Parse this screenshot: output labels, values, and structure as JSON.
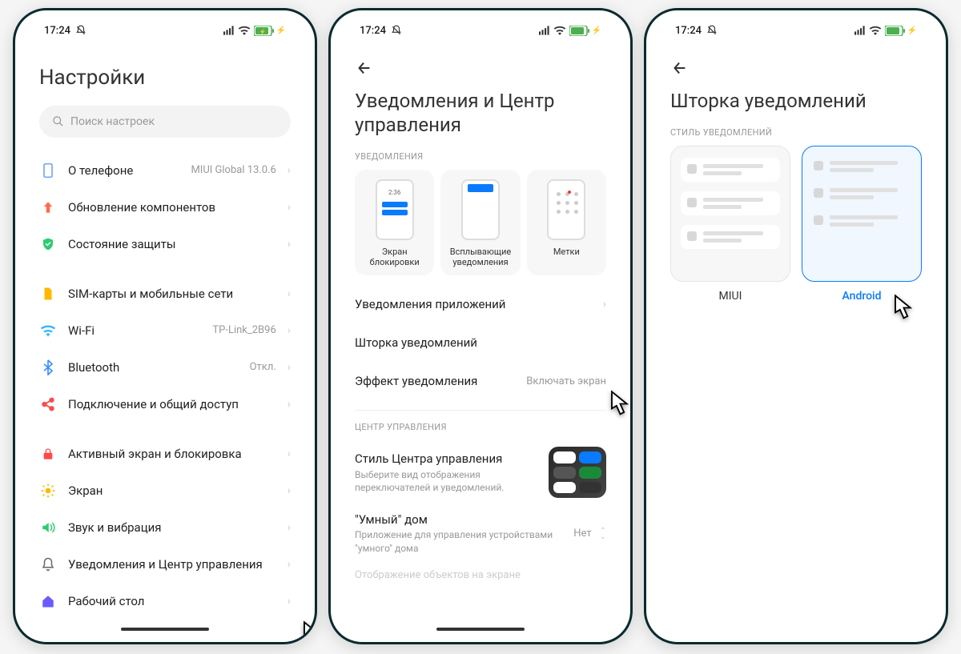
{
  "status": {
    "time": "17:24",
    "mute_icon": "bell-slash",
    "signal": "signal",
    "wifi": "wifi",
    "battery": "battery-charging"
  },
  "screen1": {
    "title": "Настройки",
    "search_placeholder": "Поиск настроек",
    "items_group1": [
      {
        "icon": "phone",
        "color": "#72a5ff",
        "label": "О телефоне",
        "value": "MIUI Global 13.0.6"
      },
      {
        "icon": "arrow-up",
        "color": "#ff6b4a",
        "label": "Обновление компонентов",
        "value": ""
      },
      {
        "icon": "shield",
        "color": "#2ecc71",
        "label": "Состояние защиты",
        "value": ""
      }
    ],
    "items_group2": [
      {
        "icon": "sim",
        "color": "#ffb800",
        "label": "SIM-карты и мобильные сети",
        "value": ""
      },
      {
        "icon": "wifi",
        "color": "#32b4ff",
        "label": "Wi-Fi",
        "value": "TP-Link_2B96"
      },
      {
        "icon": "bluetooth",
        "color": "#3a8eff",
        "label": "Bluetooth",
        "value": "Откл."
      },
      {
        "icon": "share",
        "color": "#ff4a4a",
        "label": "Подключение и общий доступ",
        "value": ""
      }
    ],
    "items_group3": [
      {
        "icon": "lock",
        "color": "#ff4a4a",
        "label": "Активный экран и блокировка",
        "value": ""
      },
      {
        "icon": "sun",
        "color": "#ffb800",
        "label": "Экран",
        "value": ""
      },
      {
        "icon": "speaker",
        "color": "#2ecc71",
        "label": "Звук и вибрация",
        "value": ""
      },
      {
        "icon": "bell",
        "color": "#666",
        "label": "Уведомления и Центр управления",
        "value": ""
      },
      {
        "icon": "home",
        "color": "#6a5aff",
        "label": "Рабочий стол",
        "value": ""
      }
    ]
  },
  "screen2": {
    "title": "Уведомления и Центр управления",
    "section_notifications": "УВЕДОМЛЕНИЯ",
    "cards": [
      {
        "label": "Экран блокировки",
        "time": "2:36"
      },
      {
        "label": "Всплывающие уведомления"
      },
      {
        "label": "Метки"
      }
    ],
    "items": [
      {
        "label": "Уведомления приложений",
        "value": ""
      },
      {
        "label": "Шторка уведомлений",
        "value": ""
      },
      {
        "label": "Эффект уведомления",
        "value": "Включать экран"
      }
    ],
    "section_control": "ЦЕНТР УПРАВЛЕНИЯ",
    "cc_label": "Стиль Центра управления",
    "cc_desc": "Выберите вид отображения переключателей и уведомлений.",
    "smart_label": "\"Умный\" дом",
    "smart_desc": "Приложение для управления устройствами \"умного\" дома",
    "smart_value": "Нет",
    "bottom_cut": "Отображение объектов на экране"
  },
  "screen3": {
    "title": "Шторка уведомлений",
    "section_style": "СТИЛЬ УВЕДОМЛЕНИЙ",
    "option_miui": "MIUI",
    "option_android": "Android"
  }
}
